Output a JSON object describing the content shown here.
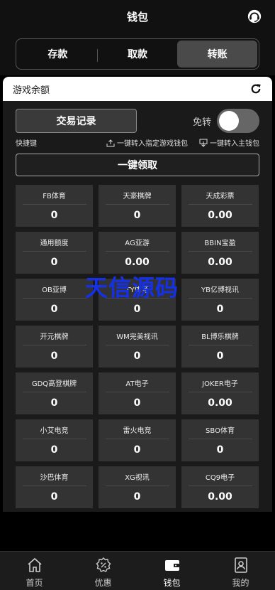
{
  "header": {
    "title": "钱包"
  },
  "tabs": [
    {
      "label": "存款"
    },
    {
      "label": "取款"
    },
    {
      "label": "转账"
    }
  ],
  "panel": {
    "title": "游戏余额",
    "transaction_button": "交易记录",
    "free_transfer_label": "免转",
    "quick_label": "快捷键",
    "link_to_game": "一键转入指定游戏钱包",
    "link_to_main": "一键转入主钱包",
    "collect_button": "一键领取"
  },
  "games": [
    {
      "name": "FB体育",
      "value": "0"
    },
    {
      "name": "天豪棋牌",
      "value": "0"
    },
    {
      "name": "天成彩票",
      "value": "0.00"
    },
    {
      "name": "通用额度",
      "value": "0"
    },
    {
      "name": "AG亚游",
      "value": "0.00"
    },
    {
      "name": "BBIN宝盈",
      "value": "0.00"
    },
    {
      "name": "OB亚博",
      "value": "0"
    },
    {
      "name": "TY体育",
      "value": "0"
    },
    {
      "name": "YB亿博视讯",
      "value": "0"
    },
    {
      "name": "开元棋牌",
      "value": "0"
    },
    {
      "name": "WM完美视讯",
      "value": "0"
    },
    {
      "name": "BL博乐棋牌",
      "value": "0"
    },
    {
      "name": "GDQ高登棋牌",
      "value": "0"
    },
    {
      "name": "AT电子",
      "value": "0"
    },
    {
      "name": "JOKER电子",
      "value": "0.00"
    },
    {
      "name": "小艾电竞",
      "value": "0"
    },
    {
      "name": "雷火电竞",
      "value": "0"
    },
    {
      "name": "SBO体育",
      "value": "0"
    },
    {
      "name": "沙巴体育",
      "value": "0"
    },
    {
      "name": "XG视讯",
      "value": "0"
    },
    {
      "name": "CQ9电子",
      "value": "0.00"
    }
  ],
  "watermark": "天信源码",
  "footer": [
    {
      "label": "首页",
      "icon": "home-icon"
    },
    {
      "label": "优惠",
      "icon": "discount-icon"
    },
    {
      "label": "钱包",
      "icon": "wallet-icon"
    },
    {
      "label": "我的",
      "icon": "profile-icon"
    }
  ],
  "colors": {
    "background": "#000000",
    "panel": "#1a1a1a",
    "cell": "#333333",
    "watermark": "#1430e8"
  }
}
